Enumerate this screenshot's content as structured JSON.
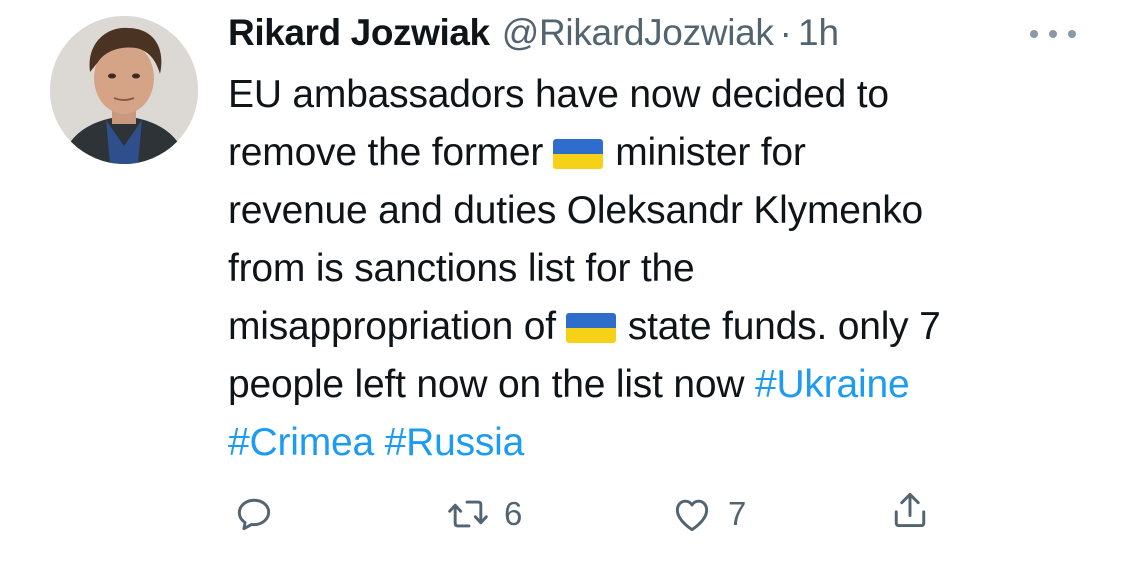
{
  "author": {
    "display_name": "Rikard Jozwiak",
    "handle": "@RikardJozwiak",
    "separator": "·",
    "time": "1h"
  },
  "tweet": {
    "line1": "EU ambassadors have now decided to",
    "line2_a": "remove the former",
    "line2_b": "minister for",
    "line3": "revenue and duties Oleksandr Klymenko",
    "line4": "from is sanctions list for the",
    "line5_a": "misappropriation of",
    "line5_b": "state funds. only 7",
    "line6_a": "people left now on the list now",
    "hashtag_ukraine": "#Ukraine",
    "hashtag_crimea": "#Crimea",
    "hashtag_russia": "#Russia"
  },
  "stats": {
    "retweets": "6",
    "likes": "7"
  },
  "icons": {
    "more": "more-icon",
    "reply": "reply-icon",
    "retweet": "retweet-icon",
    "like": "like-icon",
    "share": "share-icon",
    "flag": "ukraine-flag-emoji"
  },
  "colors": {
    "text": "#0f1419",
    "secondary": "#536471",
    "link": "#1d9bf0",
    "flag_blue": "#2f6dcd",
    "flag_yellow": "#f7d117"
  }
}
